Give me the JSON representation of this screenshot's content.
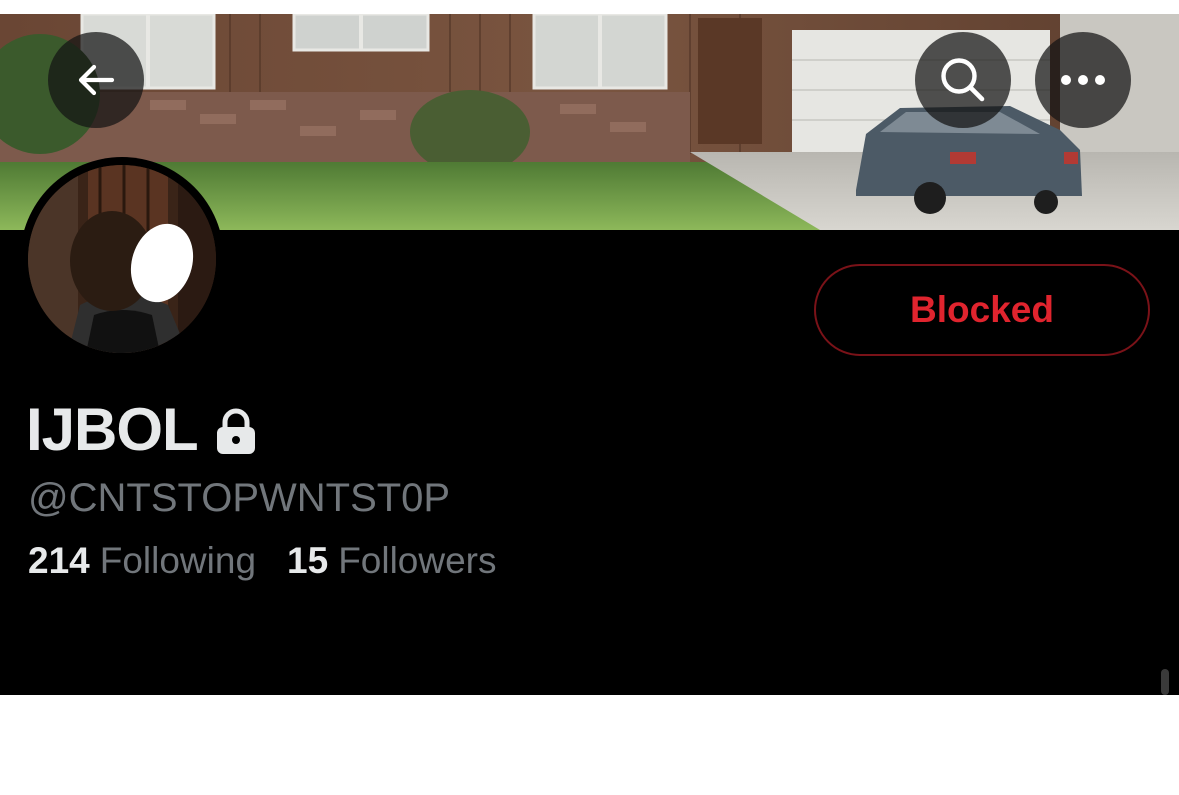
{
  "header": {
    "back_icon": "arrow-left-icon",
    "search_icon": "search-icon",
    "more_icon": "more-horizontal-icon"
  },
  "profile": {
    "display_name": "IJBOL",
    "protected_icon": "lock-icon",
    "handle": "@CNTSTOPWNTST0P",
    "following_count": "214",
    "following_label": "Following",
    "followers_count": "15",
    "followers_label": "Followers"
  },
  "actions": {
    "blocked_label": "Blocked"
  },
  "colors": {
    "background": "#000000",
    "primary_text": "#e7e9ea",
    "secondary_text": "#71767b",
    "blocked_red": "#e0242e",
    "blocked_border": "#7a1218"
  }
}
